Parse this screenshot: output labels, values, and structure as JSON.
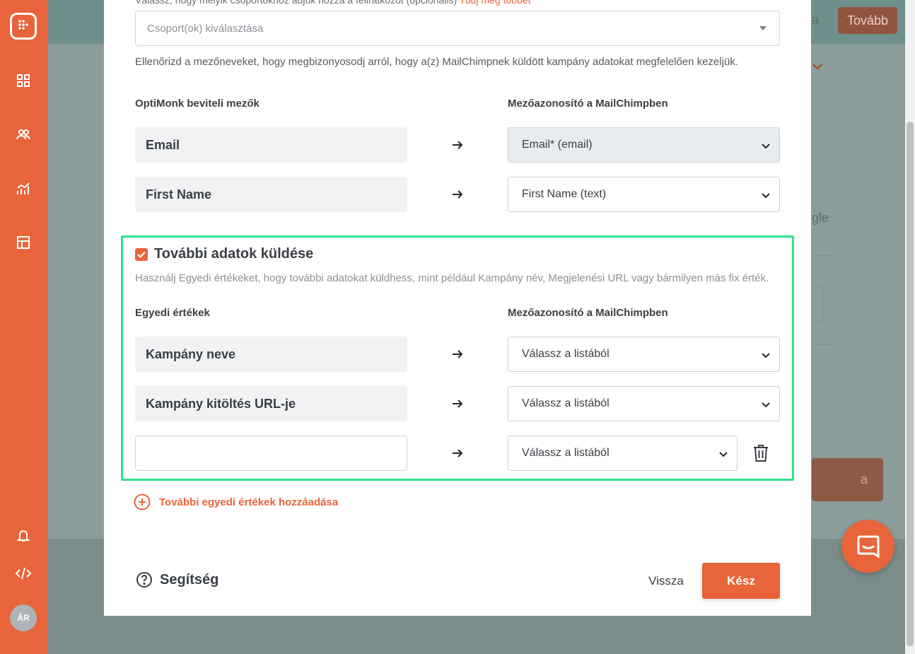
{
  "nav": {
    "avatar_initials": "ÁR"
  },
  "background": {
    "next_button": "Tovább",
    "partial_a": "a",
    "partial_gle": "gle",
    "partial_btn": "a"
  },
  "modal": {
    "cut_text": "Válassz, hogy melyik csoportokhoz adjuk hozzá a feliratkozót (opcionális)",
    "cut_link": "Tudj meg többet",
    "group_select_placeholder": "Csoport(ok) kiválasztása",
    "helper_text": "Ellenőrizd a mezőneveket, hogy megbizonyosodj arról, hogy a(z) MailChimpnek küldött kampány adatokat megfelelően kezeljük.",
    "fields_header_left": "OptiMonk beviteli mezők",
    "fields_header_right": "Mezőazonosító a MailChimpben",
    "fields": [
      {
        "label": "Email",
        "mapping": "Email* (email)"
      },
      {
        "label": "First Name",
        "mapping": "First Name (text)"
      }
    ],
    "extra": {
      "checked": true,
      "title": "További adatok küldése",
      "description": "Használj Egyedi értékeket, hogy további adatokat küldhess, mint például Kampány név, Megjelenési URL vagy bármilyen más fix érték.",
      "header_left": "Egyedi értékek",
      "header_right": "Mezőazonosító a MailChimpben",
      "rows": [
        {
          "label": "Kampány neve",
          "mapping": "Válassz a listából"
        },
        {
          "label": "Kampány kitöltés URL-je",
          "mapping": "Válassz a listából"
        },
        {
          "value": "",
          "mapping": "Válassz a listából"
        }
      ]
    },
    "add_more_label": "További egyedi értékek hozzáadása",
    "help_label": "Segítség",
    "back_label": "Vissza",
    "done_label": "Kész"
  },
  "colors": {
    "accent": "#e8643a",
    "highlight": "#2fe28a"
  }
}
